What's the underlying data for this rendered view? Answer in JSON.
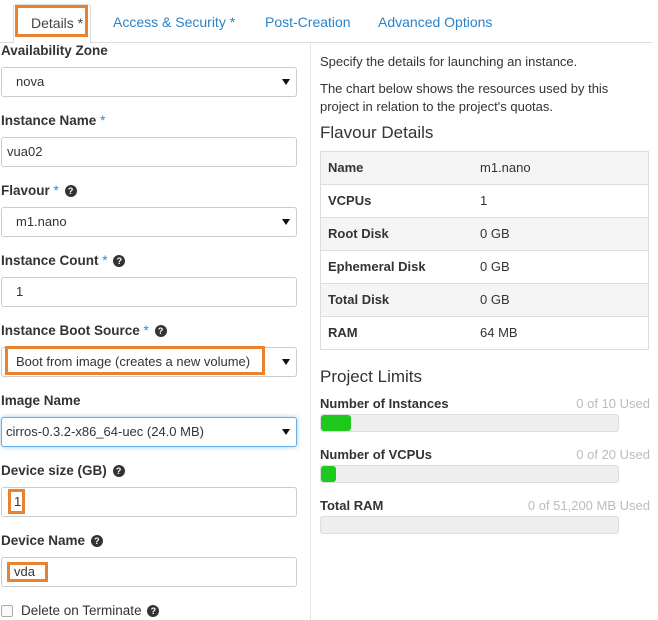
{
  "tabs": [
    {
      "label": "Details *",
      "active": true
    },
    {
      "label": "Access & Security *",
      "active": false
    },
    {
      "label": "Post-Creation",
      "active": false
    },
    {
      "label": "Advanced Options",
      "active": false
    }
  ],
  "form": {
    "availability_zone": {
      "label": "Availability Zone",
      "value": "nova"
    },
    "instance_name": {
      "label": "Instance Name",
      "required": "*",
      "value": "vua02"
    },
    "flavour": {
      "label": "Flavour",
      "required": "*",
      "value": "m1.nano"
    },
    "instance_count": {
      "label": "Instance Count",
      "required": "*",
      "value": "1"
    },
    "boot_source": {
      "label": "Instance Boot Source",
      "required": "*",
      "value": "Boot from image (creates a new volume)"
    },
    "image_name": {
      "label": "Image Name",
      "value": "cirros-0.3.2-x86_64-uec (24.0 MB)"
    },
    "device_size": {
      "label": "Device size (GB)",
      "value": "1"
    },
    "device_name": {
      "label": "Device Name",
      "value": "vda"
    },
    "delete_on_terminate": {
      "label": "Delete on Terminate",
      "checked": false
    },
    "help_glyph": "?"
  },
  "info": {
    "line1": "Specify the details for launching an instance.",
    "line2a": "The chart below shows the resources used by this",
    "line2b": "project in relation to the project's quotas."
  },
  "flavour_details": {
    "title": "Flavour Details",
    "rows": [
      {
        "key": "Name",
        "value": "m1.nano"
      },
      {
        "key": "VCPUs",
        "value": "1"
      },
      {
        "key": "Root Disk",
        "value": "0 GB"
      },
      {
        "key": "Ephemeral Disk",
        "value": "0 GB"
      },
      {
        "key": "Total Disk",
        "value": "0 GB"
      },
      {
        "key": "RAM",
        "value": "64 MB"
      }
    ]
  },
  "project_limits": {
    "title": "Project Limits",
    "items": [
      {
        "name": "Number of Instances",
        "used_text": "0 of 10 Used",
        "fill_fraction": 0.1
      },
      {
        "name": "Number of VCPUs",
        "used_text": "0 of 20 Used",
        "fill_fraction": 0.05
      },
      {
        "name": "Total RAM",
        "used_text": "0 of 51,200 MB Used",
        "fill_fraction": 0.0
      }
    ]
  },
  "colors": {
    "highlight": "#e8822e",
    "link": "#2a83c8",
    "bar_fill": "#1ec91e"
  }
}
